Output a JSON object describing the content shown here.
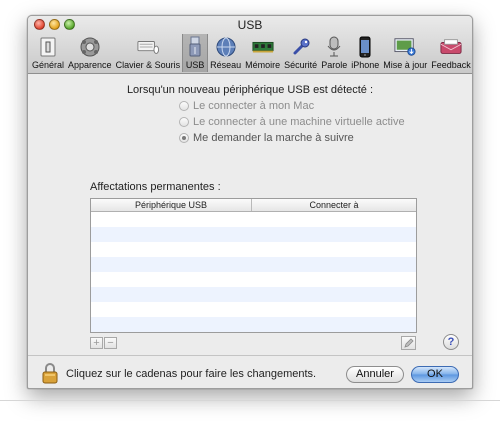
{
  "window": {
    "title": "USB"
  },
  "toolbar": {
    "items": [
      {
        "label": "Général",
        "icon": "light-switch-icon"
      },
      {
        "label": "Apparence",
        "icon": "gear-cluster-icon"
      },
      {
        "label": "Clavier & Souris",
        "icon": "keyboard-mouse-icon"
      },
      {
        "label": "USB",
        "icon": "usb-icon",
        "selected": true
      },
      {
        "label": "Réseau",
        "icon": "globe-icon"
      },
      {
        "label": "Mémoire",
        "icon": "memory-chip-icon"
      },
      {
        "label": "Sécurité",
        "icon": "key-icon"
      },
      {
        "label": "Parole",
        "icon": "microphone-icon"
      },
      {
        "label": "iPhone",
        "icon": "iphone-icon"
      },
      {
        "label": "Mise à jour",
        "icon": "software-update-icon"
      },
      {
        "label": "Feedback",
        "icon": "feedback-icon"
      }
    ]
  },
  "detection": {
    "title": "Lorsqu'un nouveau périphérique USB est détecté :",
    "options": [
      {
        "label": "Le connecter à mon Mac",
        "checked": false
      },
      {
        "label": "Le connecter à une machine virtuelle active",
        "checked": false
      },
      {
        "label": "Me demander la marche à suivre",
        "checked": true
      }
    ]
  },
  "assignments": {
    "title": "Affectations permanentes :",
    "columns": [
      "Périphérique USB",
      "Connecter à"
    ],
    "rows": []
  },
  "footer": {
    "lock_text": "Cliquez sur le cadenas pour faire les changements.",
    "cancel_label": "Annuler",
    "ok_label": "OK",
    "add_label": "+",
    "remove_label": "−",
    "help_label": "?"
  },
  "colors": {
    "selection_accent": "#5b96e0",
    "alt_row": "#edf3fe"
  }
}
